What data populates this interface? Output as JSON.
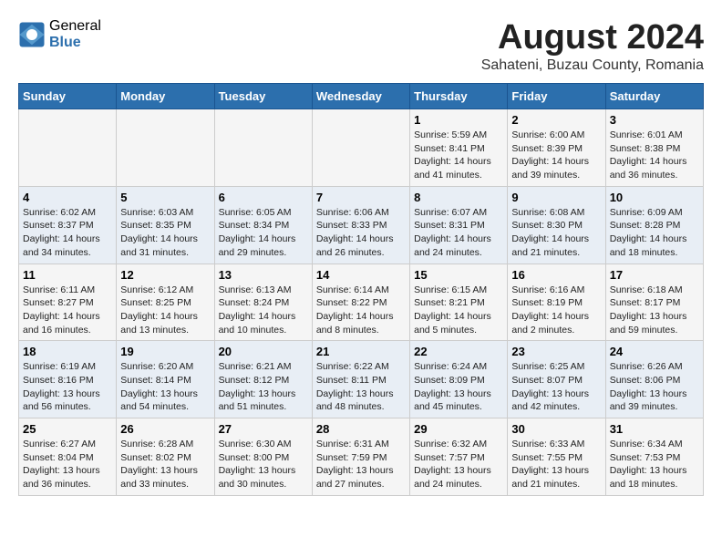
{
  "header": {
    "logo_general": "General",
    "logo_blue": "Blue",
    "title": "August 2024",
    "subtitle": "Sahateni, Buzau County, Romania"
  },
  "days_of_week": [
    "Sunday",
    "Monday",
    "Tuesday",
    "Wednesday",
    "Thursday",
    "Friday",
    "Saturday"
  ],
  "weeks": [
    [
      {
        "num": "",
        "info": ""
      },
      {
        "num": "",
        "info": ""
      },
      {
        "num": "",
        "info": ""
      },
      {
        "num": "",
        "info": ""
      },
      {
        "num": "1",
        "info": "Sunrise: 5:59 AM\nSunset: 8:41 PM\nDaylight: 14 hours and 41 minutes."
      },
      {
        "num": "2",
        "info": "Sunrise: 6:00 AM\nSunset: 8:39 PM\nDaylight: 14 hours and 39 minutes."
      },
      {
        "num": "3",
        "info": "Sunrise: 6:01 AM\nSunset: 8:38 PM\nDaylight: 14 hours and 36 minutes."
      }
    ],
    [
      {
        "num": "4",
        "info": "Sunrise: 6:02 AM\nSunset: 8:37 PM\nDaylight: 14 hours and 34 minutes."
      },
      {
        "num": "5",
        "info": "Sunrise: 6:03 AM\nSunset: 8:35 PM\nDaylight: 14 hours and 31 minutes."
      },
      {
        "num": "6",
        "info": "Sunrise: 6:05 AM\nSunset: 8:34 PM\nDaylight: 14 hours and 29 minutes."
      },
      {
        "num": "7",
        "info": "Sunrise: 6:06 AM\nSunset: 8:33 PM\nDaylight: 14 hours and 26 minutes."
      },
      {
        "num": "8",
        "info": "Sunrise: 6:07 AM\nSunset: 8:31 PM\nDaylight: 14 hours and 24 minutes."
      },
      {
        "num": "9",
        "info": "Sunrise: 6:08 AM\nSunset: 8:30 PM\nDaylight: 14 hours and 21 minutes."
      },
      {
        "num": "10",
        "info": "Sunrise: 6:09 AM\nSunset: 8:28 PM\nDaylight: 14 hours and 18 minutes."
      }
    ],
    [
      {
        "num": "11",
        "info": "Sunrise: 6:11 AM\nSunset: 8:27 PM\nDaylight: 14 hours and 16 minutes."
      },
      {
        "num": "12",
        "info": "Sunrise: 6:12 AM\nSunset: 8:25 PM\nDaylight: 14 hours and 13 minutes."
      },
      {
        "num": "13",
        "info": "Sunrise: 6:13 AM\nSunset: 8:24 PM\nDaylight: 14 hours and 10 minutes."
      },
      {
        "num": "14",
        "info": "Sunrise: 6:14 AM\nSunset: 8:22 PM\nDaylight: 14 hours and 8 minutes."
      },
      {
        "num": "15",
        "info": "Sunrise: 6:15 AM\nSunset: 8:21 PM\nDaylight: 14 hours and 5 minutes."
      },
      {
        "num": "16",
        "info": "Sunrise: 6:16 AM\nSunset: 8:19 PM\nDaylight: 14 hours and 2 minutes."
      },
      {
        "num": "17",
        "info": "Sunrise: 6:18 AM\nSunset: 8:17 PM\nDaylight: 13 hours and 59 minutes."
      }
    ],
    [
      {
        "num": "18",
        "info": "Sunrise: 6:19 AM\nSunset: 8:16 PM\nDaylight: 13 hours and 56 minutes."
      },
      {
        "num": "19",
        "info": "Sunrise: 6:20 AM\nSunset: 8:14 PM\nDaylight: 13 hours and 54 minutes."
      },
      {
        "num": "20",
        "info": "Sunrise: 6:21 AM\nSunset: 8:12 PM\nDaylight: 13 hours and 51 minutes."
      },
      {
        "num": "21",
        "info": "Sunrise: 6:22 AM\nSunset: 8:11 PM\nDaylight: 13 hours and 48 minutes."
      },
      {
        "num": "22",
        "info": "Sunrise: 6:24 AM\nSunset: 8:09 PM\nDaylight: 13 hours and 45 minutes."
      },
      {
        "num": "23",
        "info": "Sunrise: 6:25 AM\nSunset: 8:07 PM\nDaylight: 13 hours and 42 minutes."
      },
      {
        "num": "24",
        "info": "Sunrise: 6:26 AM\nSunset: 8:06 PM\nDaylight: 13 hours and 39 minutes."
      }
    ],
    [
      {
        "num": "25",
        "info": "Sunrise: 6:27 AM\nSunset: 8:04 PM\nDaylight: 13 hours and 36 minutes."
      },
      {
        "num": "26",
        "info": "Sunrise: 6:28 AM\nSunset: 8:02 PM\nDaylight: 13 hours and 33 minutes."
      },
      {
        "num": "27",
        "info": "Sunrise: 6:30 AM\nSunset: 8:00 PM\nDaylight: 13 hours and 30 minutes."
      },
      {
        "num": "28",
        "info": "Sunrise: 6:31 AM\nSunset: 7:59 PM\nDaylight: 13 hours and 27 minutes."
      },
      {
        "num": "29",
        "info": "Sunrise: 6:32 AM\nSunset: 7:57 PM\nDaylight: 13 hours and 24 minutes."
      },
      {
        "num": "30",
        "info": "Sunrise: 6:33 AM\nSunset: 7:55 PM\nDaylight: 13 hours and 21 minutes."
      },
      {
        "num": "31",
        "info": "Sunrise: 6:34 AM\nSunset: 7:53 PM\nDaylight: 13 hours and 18 minutes."
      }
    ]
  ]
}
